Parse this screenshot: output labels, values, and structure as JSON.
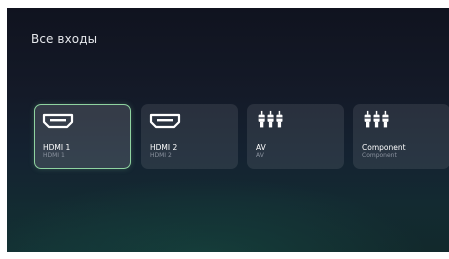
{
  "screen": {
    "title": "Все входы"
  },
  "inputs": [
    {
      "label": "HDMI 1",
      "sublabel": "HDMI 1",
      "icon": "hdmi-icon",
      "selected": true
    },
    {
      "label": "HDMI 2",
      "sublabel": "HDMI 2",
      "icon": "hdmi-icon",
      "selected": false
    },
    {
      "label": "AV",
      "sublabel": "AV",
      "icon": "rca-connector-icon",
      "selected": false
    },
    {
      "label": "Component",
      "sublabel": "Component",
      "icon": "rca-connector-icon",
      "selected": false
    }
  ],
  "colors": {
    "selected_border": "#8fd3a0",
    "label": "#ffffff",
    "sublabel": "#8a929e",
    "background_top": "#10131f",
    "background_bottom": "#12292c"
  }
}
